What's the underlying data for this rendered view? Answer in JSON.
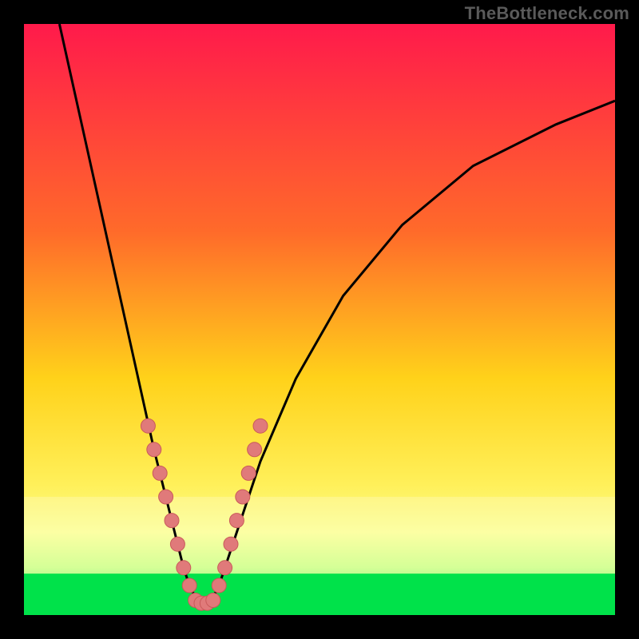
{
  "watermark": "TheBottleneck.com",
  "chart_data": {
    "type": "line",
    "title": "",
    "xlabel": "",
    "ylabel": "",
    "xlim": [
      0,
      100
    ],
    "ylim": [
      0,
      100
    ],
    "series": [
      {
        "name": "bottleneck-curve",
        "x": [
          6,
          10,
          14,
          18,
          22,
          24,
          26,
          27,
          28,
          29,
          30,
          31,
          32,
          33,
          34,
          36,
          40,
          46,
          54,
          64,
          76,
          90,
          100
        ],
        "y": [
          100,
          82,
          64,
          46,
          28,
          20,
          12,
          8,
          5,
          3,
          2,
          2,
          3,
          5,
          8,
          14,
          26,
          40,
          54,
          66,
          76,
          83,
          87
        ]
      }
    ],
    "markers_left": [
      [
        21,
        32
      ],
      [
        22,
        28
      ],
      [
        23,
        24
      ],
      [
        24,
        20
      ],
      [
        25,
        16
      ],
      [
        26,
        12
      ],
      [
        27,
        8
      ],
      [
        28,
        5
      ]
    ],
    "markers_right": [
      [
        33,
        5
      ],
      [
        34,
        8
      ],
      [
        35,
        12
      ],
      [
        36,
        16
      ],
      [
        37,
        20
      ],
      [
        38,
        24
      ],
      [
        39,
        28
      ],
      [
        40,
        32
      ]
    ],
    "markers_bottom": [
      [
        29,
        2.5
      ],
      [
        30,
        2
      ],
      [
        31,
        2
      ],
      [
        32,
        2.5
      ]
    ],
    "gradient_stops": [
      {
        "offset": 0,
        "color": "#ff1a4b"
      },
      {
        "offset": 35,
        "color": "#ff6a2a"
      },
      {
        "offset": 60,
        "color": "#ffd21a"
      },
      {
        "offset": 78,
        "color": "#fff05a"
      },
      {
        "offset": 86,
        "color": "#fbff8a"
      },
      {
        "offset": 92,
        "color": "#c9ff7a"
      },
      {
        "offset": 100,
        "color": "#00e24a"
      }
    ],
    "green_band": {
      "top_pct": 93,
      "bottom_pct": 100
    },
    "pale_band": {
      "top_pct": 80,
      "bottom_pct": 93
    }
  },
  "colors": {
    "frame": "#000000",
    "curve": "#000000",
    "marker_fill": "#e07a7a",
    "marker_stroke": "#c95a5a",
    "watermark": "#5a5a5a"
  }
}
